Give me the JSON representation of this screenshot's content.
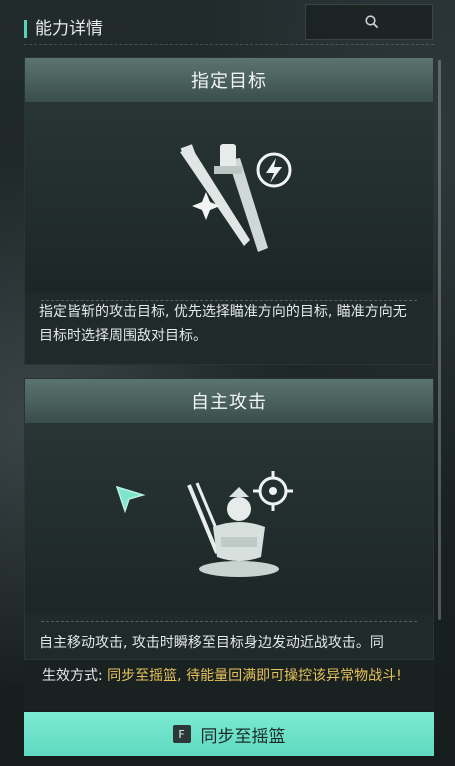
{
  "header": {
    "title": "能力详情"
  },
  "search": {
    "icon": "search-icon"
  },
  "abilities": [
    {
      "title": "指定目标",
      "description": "指定皆斩的攻击目标, 优先选择瞄准方向的目标, 瞄准方向无目标时选择周围敌对目标。",
      "icon": "sword-target-icon"
    },
    {
      "title": "自主攻击",
      "description": "自主移动攻击, 攻击时瞬移至目标身边发动近战攻击。同",
      "icon": "auto-attack-icon"
    }
  ],
  "effect": {
    "label": "生效方式: ",
    "text": "同步至摇篮, 待能量回满即可操控该异常物战斗!"
  },
  "button": {
    "key": "F",
    "label": "同步至摇篮"
  },
  "colors": {
    "accent": "#5fd9bf",
    "highlight": "#e7c45a",
    "header_bar": "#58d3b9"
  }
}
